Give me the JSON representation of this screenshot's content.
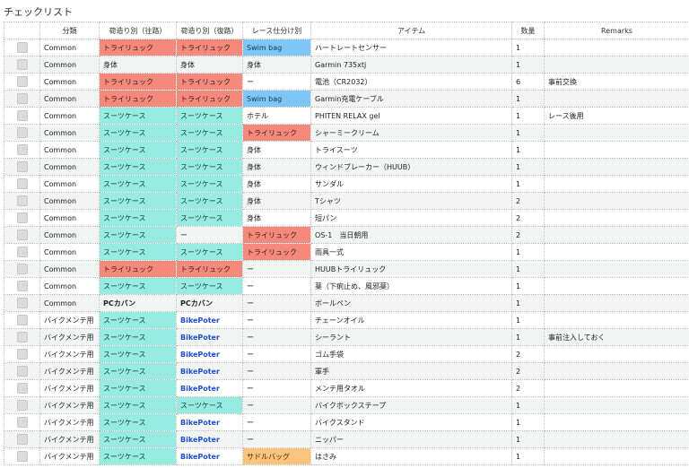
{
  "page": {
    "title": "チェックリスト"
  },
  "colors": {
    "salmon": "#f4897c",
    "teal": "#96ece1",
    "blue": "#7fc6f4",
    "orange": "#f9c47e",
    "link": "#1f4fd4"
  },
  "table": {
    "headers": [
      "分類",
      "荷造り別（往路）",
      "荷造り別（復路）",
      "レース仕分け別",
      "アイテム",
      "数量",
      "Remarks"
    ],
    "rows": [
      {
        "category": "Common",
        "outbound": "トライリュック",
        "return": "トライリュック",
        "race": "Swim bag",
        "item": "ハートレートセンサー",
        "qty": "1",
        "remarks": "",
        "outbound_style": "salmon",
        "return_style": "salmon",
        "race_style": "blue"
      },
      {
        "category": "Common",
        "outbound": "身体",
        "return": "身体",
        "race": "身体",
        "item": "Garmin 735xtj",
        "qty": "1",
        "remarks": "",
        "outbound_style": "",
        "return_style": "",
        "race_style": ""
      },
      {
        "category": "Common",
        "outbound": "トライリュック",
        "return": "トライリュック",
        "race": "ー",
        "item": "電池（CR2032）",
        "qty": "6",
        "remarks": "事前交換",
        "outbound_style": "salmon",
        "return_style": "salmon",
        "race_style": ""
      },
      {
        "category": "Common",
        "outbound": "トライリュック",
        "return": "トライリュック",
        "race": "Swim bag",
        "item": "Garmin充電ケーブル",
        "qty": "1",
        "remarks": "",
        "outbound_style": "salmon",
        "return_style": "salmon",
        "race_style": "blue"
      },
      {
        "category": "Common",
        "outbound": "スーツケース",
        "return": "スーツケース",
        "race": "ホテル",
        "item": "PHITEN RELAX gel",
        "qty": "1",
        "remarks": "レース後用",
        "outbound_style": "teal",
        "return_style": "teal",
        "race_style": ""
      },
      {
        "category": "Common",
        "outbound": "スーツケース",
        "return": "スーツケース",
        "race": "トライリュック",
        "item": "シャーミークリーム",
        "qty": "1",
        "remarks": "",
        "outbound_style": "teal",
        "return_style": "teal",
        "race_style": "salmon"
      },
      {
        "category": "Common",
        "outbound": "スーツケース",
        "return": "スーツケース",
        "race": "身体",
        "item": "トライスーツ",
        "qty": "1",
        "remarks": "",
        "outbound_style": "teal",
        "return_style": "teal",
        "race_style": ""
      },
      {
        "category": "Common",
        "outbound": "スーツケース",
        "return": "スーツケース",
        "race": "身体",
        "item": "ウィンドブレーカー（HUUB）",
        "qty": "1",
        "remarks": "",
        "outbound_style": "teal",
        "return_style": "teal",
        "race_style": ""
      },
      {
        "category": "Common",
        "outbound": "スーツケース",
        "return": "スーツケース",
        "race": "身体",
        "item": "サンダル",
        "qty": "1",
        "remarks": "",
        "outbound_style": "teal",
        "return_style": "teal",
        "race_style": ""
      },
      {
        "category": "Common",
        "outbound": "スーツケース",
        "return": "スーツケース",
        "race": "身体",
        "item": "Tシャツ",
        "qty": "2",
        "remarks": "",
        "outbound_style": "teal",
        "return_style": "teal",
        "race_style": ""
      },
      {
        "category": "Common",
        "outbound": "スーツケース",
        "return": "スーツケース",
        "race": "身体",
        "item": "短パン",
        "qty": "2",
        "remarks": "",
        "outbound_style": "teal",
        "return_style": "teal",
        "race_style": ""
      },
      {
        "category": "Common",
        "outbound": "スーツケース",
        "return": "ー",
        "race": "トライリュック",
        "item": "OS-1　当日朝用",
        "qty": "2",
        "remarks": "",
        "outbound_style": "teal",
        "return_style": "",
        "race_style": "salmon"
      },
      {
        "category": "Common",
        "outbound": "スーツケース",
        "return": "スーツケース",
        "race": "トライリュック",
        "item": "雨具一式",
        "qty": "1",
        "remarks": "",
        "outbound_style": "teal",
        "return_style": "teal",
        "race_style": "salmon"
      },
      {
        "category": "Common",
        "outbound": "トライリュック",
        "return": "トライリュック",
        "race": "ー",
        "item": "HUUBトライリュック",
        "qty": "1",
        "remarks": "",
        "outbound_style": "salmon",
        "return_style": "salmon",
        "race_style": ""
      },
      {
        "category": "Common",
        "outbound": "スーツケース",
        "return": "スーツケース",
        "race": "ー",
        "item": "薬（下痢止め、風邪薬）",
        "qty": "1",
        "remarks": "",
        "outbound_style": "teal",
        "return_style": "teal",
        "race_style": ""
      },
      {
        "category": "Common",
        "outbound": "PCカバン",
        "return": "PCカバン",
        "race": "ー",
        "item": "ボールペン",
        "qty": "1",
        "remarks": "",
        "outbound_style": "bold",
        "return_style": "bold",
        "race_style": ""
      },
      {
        "category": "バイクメンテ用",
        "outbound": "スーツケース",
        "return": "BikePoter",
        "race": "ー",
        "item": "チェーンオイル",
        "qty": "1",
        "remarks": "",
        "outbound_style": "teal",
        "return_style": "link",
        "race_style": ""
      },
      {
        "category": "バイクメンテ用",
        "outbound": "スーツケース",
        "return": "BikePoter",
        "race": "ー",
        "item": "シーラント",
        "qty": "1",
        "remarks": "事前注入しておく",
        "outbound_style": "teal",
        "return_style": "link",
        "race_style": ""
      },
      {
        "category": "バイクメンテ用",
        "outbound": "スーツケース",
        "return": "BikePoter",
        "race": "ー",
        "item": "ゴム手袋",
        "qty": "2",
        "remarks": "",
        "outbound_style": "teal",
        "return_style": "link",
        "race_style": ""
      },
      {
        "category": "バイクメンテ用",
        "outbound": "スーツケース",
        "return": "BikePoter",
        "race": "ー",
        "item": "軍手",
        "qty": "2",
        "remarks": "",
        "outbound_style": "teal",
        "return_style": "link",
        "race_style": ""
      },
      {
        "category": "バイクメンテ用",
        "outbound": "スーツケース",
        "return": "BikePoter",
        "race": "ー",
        "item": "メンテ用タオル",
        "qty": "2",
        "remarks": "",
        "outbound_style": "teal",
        "return_style": "link",
        "race_style": ""
      },
      {
        "category": "バイクメンテ用",
        "outbound": "スーツケース",
        "return": "スーツケース",
        "race": "ー",
        "item": "バイクボックステープ",
        "qty": "1",
        "remarks": "",
        "outbound_style": "teal",
        "return_style": "teal",
        "race_style": ""
      },
      {
        "category": "バイクメンテ用",
        "outbound": "スーツケース",
        "return": "BikePoter",
        "race": "ー",
        "item": "バイクスタンド",
        "qty": "1",
        "remarks": "",
        "outbound_style": "teal",
        "return_style": "link",
        "race_style": ""
      },
      {
        "category": "バイクメンテ用",
        "outbound": "スーツケース",
        "return": "BikePoter",
        "race": "ー",
        "item": "ニッパー",
        "qty": "1",
        "remarks": "",
        "outbound_style": "teal",
        "return_style": "link",
        "race_style": ""
      },
      {
        "category": "バイクメンテ用",
        "outbound": "スーツケース",
        "return": "BikePoter",
        "race": "サドルバッグ",
        "item": "はさみ",
        "qty": "1",
        "remarks": "",
        "outbound_style": "teal",
        "return_style": "link",
        "race_style": "orange"
      }
    ]
  }
}
